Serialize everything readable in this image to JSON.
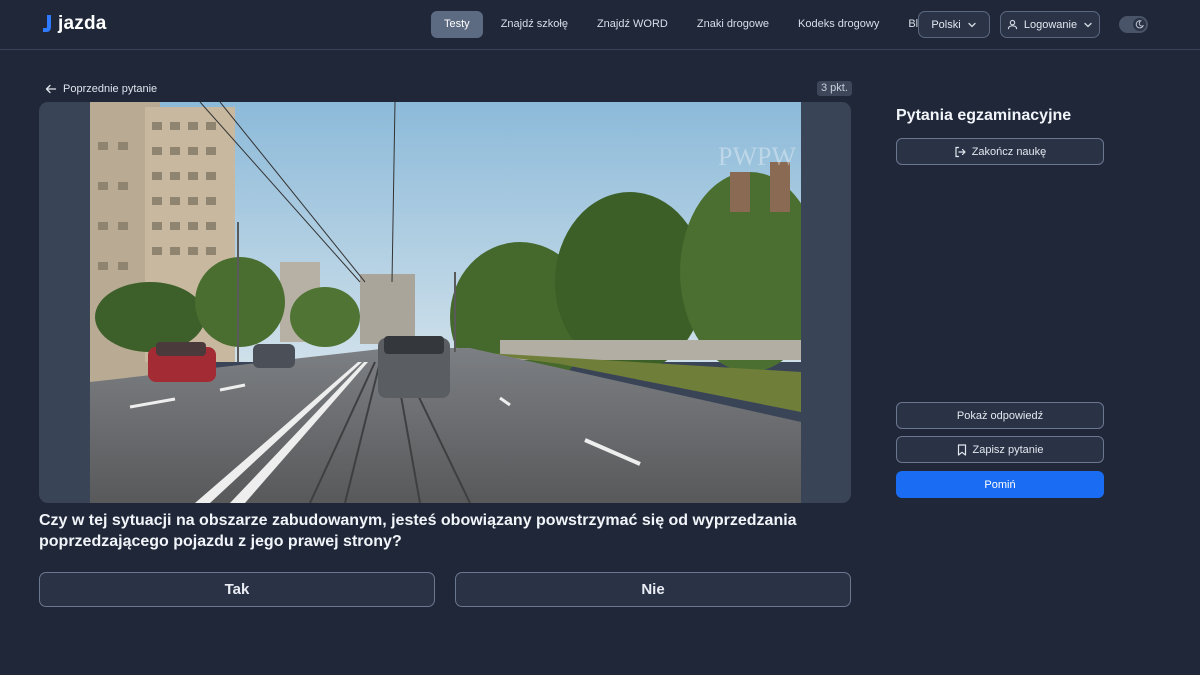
{
  "header": {
    "logo_text": "jazda",
    "nav": [
      {
        "label": "Testy",
        "active": true
      },
      {
        "label": "Znajdź szkołę",
        "active": false
      },
      {
        "label": "Znajdź WORD",
        "active": false
      },
      {
        "label": "Znaki drogowe",
        "active": false
      },
      {
        "label": "Kodeks drogowy",
        "active": false
      },
      {
        "label": "Blog",
        "active": false
      }
    ],
    "language_label": "Polski",
    "login_label": "Logowanie",
    "theme_toggle_icon": "moon-icon"
  },
  "question_view": {
    "back_label": "Poprzednie pytanie",
    "points_label": "3 pkt.",
    "media_watermark": "PWPW",
    "question_text": "Czy w tej sytuacji na obszarze zabudowanym, jesteś obowiązany powstrzymać się od wyprzedzania poprzedzającego pojazdu z jego prawej strony?",
    "answers": [
      {
        "label": "Tak"
      },
      {
        "label": "Nie"
      }
    ]
  },
  "side_panel": {
    "title": "Pytania egzaminacyjne",
    "end_label": "Zakończ naukę",
    "show_answer_label": "Pokaż odpowiedź",
    "save_label": "Zapisz pytanie",
    "skip_label": "Pomiń"
  },
  "colors": {
    "background": "#1f2739",
    "primary": "#1a6cf2",
    "active_nav": "#5c6a82"
  }
}
